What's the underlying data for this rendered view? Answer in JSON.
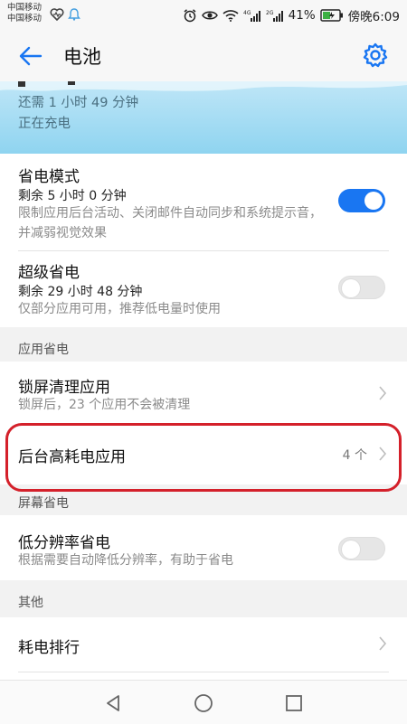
{
  "status_bar": {
    "carrier_1": "中国移动",
    "carrier_2": "中国移动",
    "battery_percent": "41%",
    "time": "傍晚6:09"
  },
  "app_bar": {
    "title": "电池"
  },
  "battery_header": {
    "remaining": "还需 1 小时 49 分钟",
    "status": "正在充电"
  },
  "power_saving": {
    "title": "省电模式",
    "remaining": "剩余 5 小时 0 分钟",
    "description": "限制应用后台活动、关闭邮件自动同步和系统提示音，并减弱视觉效果",
    "enabled": true
  },
  "ultra_saving": {
    "title": "超级省电",
    "remaining": "剩余 29 小时 48 分钟",
    "description": "仅部分应用可用，推荐低电量时使用",
    "enabled": false
  },
  "app_section": {
    "label": "应用省电",
    "lock_screen_cleanup": {
      "title": "锁屏清理应用",
      "description": "锁屏后，23 个应用不会被清理"
    },
    "background_high_usage": {
      "title": "后台高耗电应用",
      "count": "4 个"
    }
  },
  "screen_section": {
    "label": "屏幕省电",
    "low_resolution": {
      "title": "低分辨率省电",
      "description": "根据需要自动降低分辨率，有助于省电",
      "enabled": false
    }
  },
  "other_section": {
    "label": "其他",
    "usage_ranking": {
      "title": "耗电排行"
    }
  },
  "colors": {
    "accent": "#1976f2",
    "highlight": "#d4202a",
    "header_gradient_top": "#bfe6f7",
    "header_gradient_bottom": "#8fd4f0"
  }
}
